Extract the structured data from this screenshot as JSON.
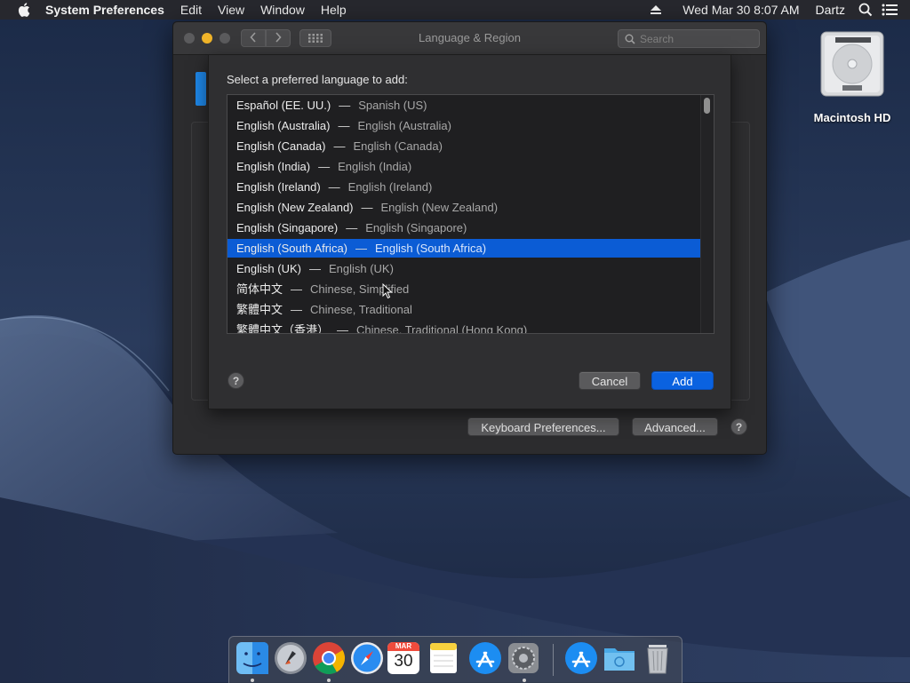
{
  "menubar": {
    "app_name": "System Preferences",
    "menus": [
      "Edit",
      "View",
      "Window",
      "Help"
    ],
    "clock": "Wed Mar 30  8:07 AM",
    "user": "Dartz"
  },
  "window": {
    "title": "Language & Region",
    "search_placeholder": "Search",
    "buttons": {
      "keyboard_prefs": "Keyboard Preferences...",
      "advanced": "Advanced...",
      "help": "?"
    }
  },
  "sheet": {
    "prompt": "Select a preferred language to add:",
    "languages": [
      {
        "native": "Español (EE. UU.)",
        "english": "Spanish (US)"
      },
      {
        "native": "English (Australia)",
        "english": "English (Australia)"
      },
      {
        "native": "English (Canada)",
        "english": "English (Canada)"
      },
      {
        "native": "English (India)",
        "english": "English (India)"
      },
      {
        "native": "English (Ireland)",
        "english": "English (Ireland)"
      },
      {
        "native": "English (New Zealand)",
        "english": "English (New Zealand)"
      },
      {
        "native": "English (Singapore)",
        "english": "English (Singapore)"
      },
      {
        "native": "English (South Africa)",
        "english": "English (South Africa)"
      },
      {
        "native": "English (UK)",
        "english": "English (UK)"
      },
      {
        "native": "简体中文",
        "english": "Chinese, Simplified"
      },
      {
        "native": "繁體中文",
        "english": "Chinese, Traditional"
      },
      {
        "native": "繁體中文（香港）",
        "english": "Chinese, Traditional (Hong Kong)"
      }
    ],
    "separator": "—",
    "selected_index": 7,
    "buttons": {
      "cancel": "Cancel",
      "add": "Add",
      "help": "?"
    }
  },
  "desktop": {
    "hd_label": "Macintosh HD"
  },
  "dock": {
    "items": [
      "finder-icon",
      "launchpad-icon",
      "chrome-icon",
      "safari-icon",
      "calendar-icon",
      "notes-icon",
      "app-store-icon",
      "system-preferences-icon",
      "app-store-download-icon",
      "downloads-folder-icon",
      "trash-icon"
    ],
    "calendar_month": "MAR",
    "calendar_day": "30"
  },
  "colors": {
    "selection": "#0b5cd5",
    "accent_button": "#0a62e0"
  }
}
